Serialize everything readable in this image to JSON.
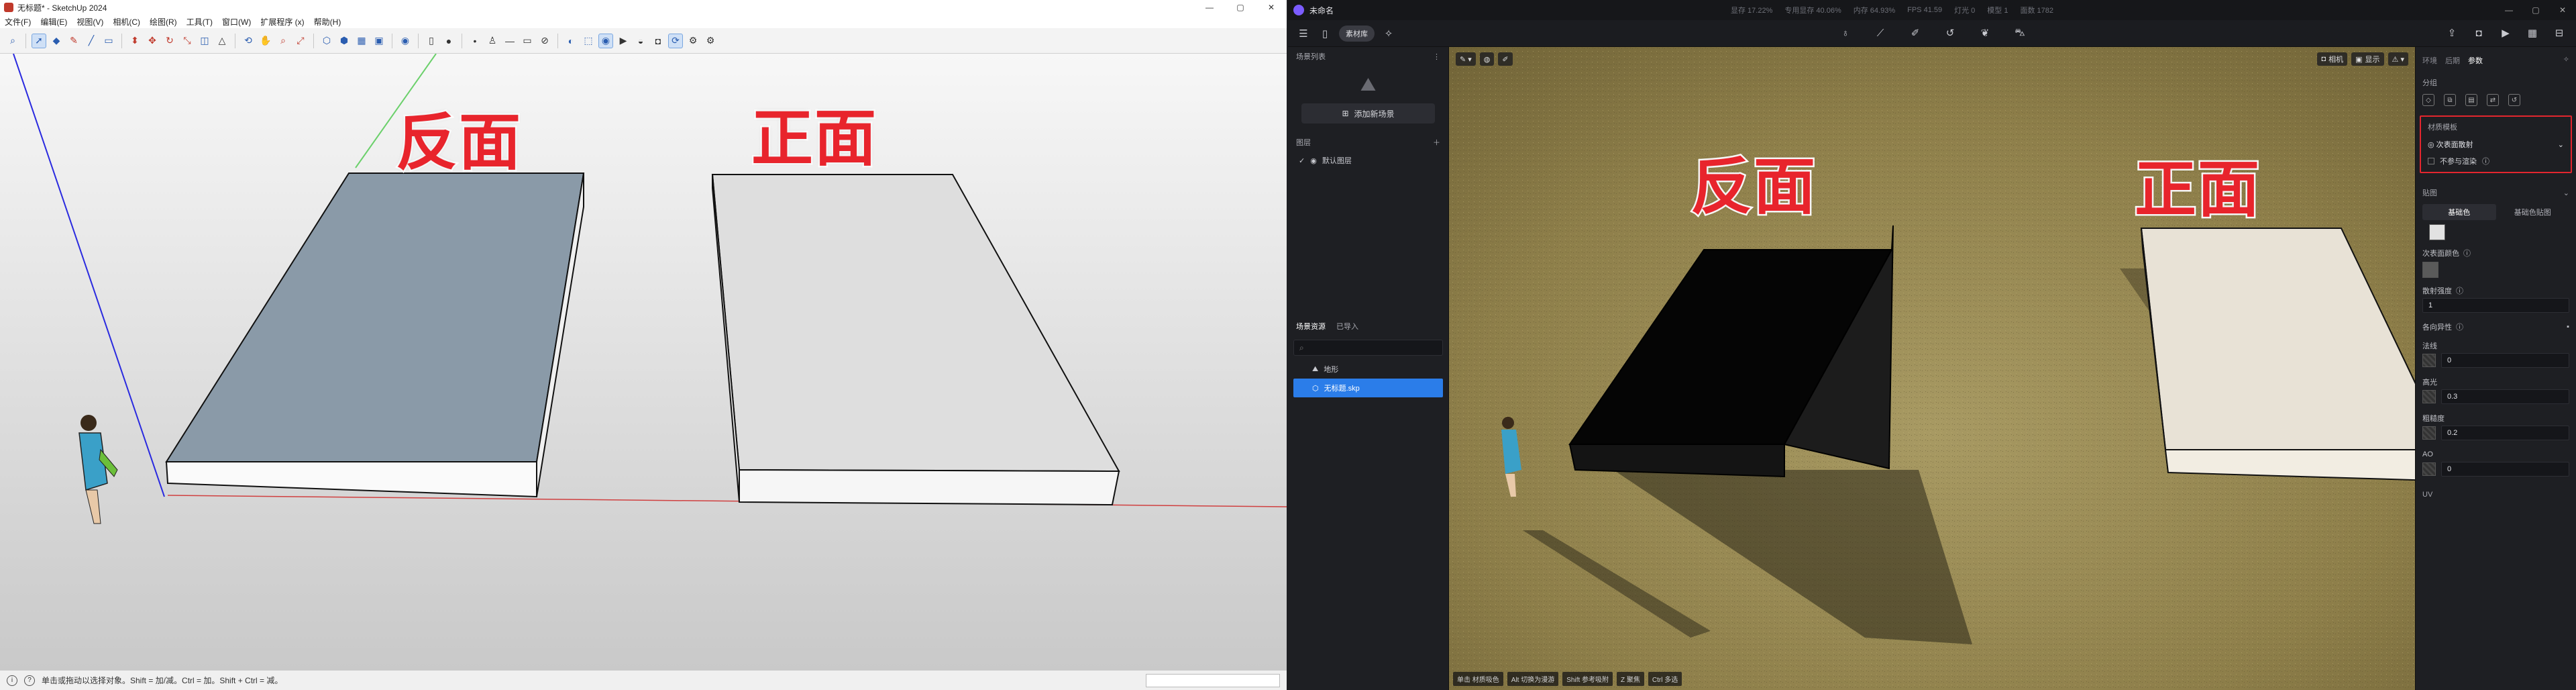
{
  "sketchup": {
    "title": "无标题* - SketchUp 2024",
    "window_controls": [
      "—",
      "▢",
      "✕"
    ],
    "menu": [
      "文件(F)",
      "编辑(E)",
      "视图(V)",
      "相机(C)",
      "绘图(R)",
      "工具(T)",
      "窗口(W)",
      "扩展程序 (x)",
      "帮助(H)"
    ],
    "label_back": "反面",
    "label_front": "正面",
    "status_text": "单击或拖动以选择对象。Shift = 加/减。Ctrl = 加。Shift + Ctrl = 减。"
  },
  "render": {
    "title": "未命名",
    "stats": [
      "显存 17.22%",
      "专用显存 40.06%",
      "内存 64.93%",
      "FPS 41.59",
      "灯光 0",
      "模型 1",
      "面数 1782"
    ],
    "window_controls": [
      "—",
      "▢",
      "✕"
    ],
    "material_lib_button": "素材库",
    "scene_list_header": "场景列表",
    "add_scene_button": "添加新场景",
    "layers_header": "图层",
    "default_layer": "默认图层",
    "asset_tabs": [
      "场景资源",
      "已导入"
    ],
    "assets": [
      "地形",
      "无标题.skp"
    ],
    "viewport_label_back": "反面",
    "viewport_label_front": "正面",
    "viewport_right_chips": [
      "相机",
      "显示"
    ],
    "viewport_hints": [
      "单击 材质吸色",
      "Alt 切换为漫游",
      "Shift 参考吸附",
      "Z 聚焦",
      "Ctrl 多选"
    ],
    "right_tabs": [
      "环境",
      "后期",
      "参数"
    ],
    "right_active_tab": "参数",
    "section_object": "分组",
    "material_mode_label": "材质模板",
    "material_mode_value": "次表面散射",
    "no_render_label": "不参与渲染",
    "texture_section": "贴图",
    "subtabs": [
      "基础色",
      "基础色贴图"
    ],
    "sss_color_label": "次表面颜色",
    "sss_strength_label": "散射强度",
    "sss_strength_value": "1",
    "anisotropic_label": "各向异性",
    "normal_label": "法线",
    "normal_value": "0",
    "specular_label": "高光",
    "specular_value": "0.3",
    "roughness_label": "粗糙度",
    "roughness_value": "0.2",
    "ao_label": "AO",
    "ao_value": "0",
    "uv_label": "UV"
  }
}
